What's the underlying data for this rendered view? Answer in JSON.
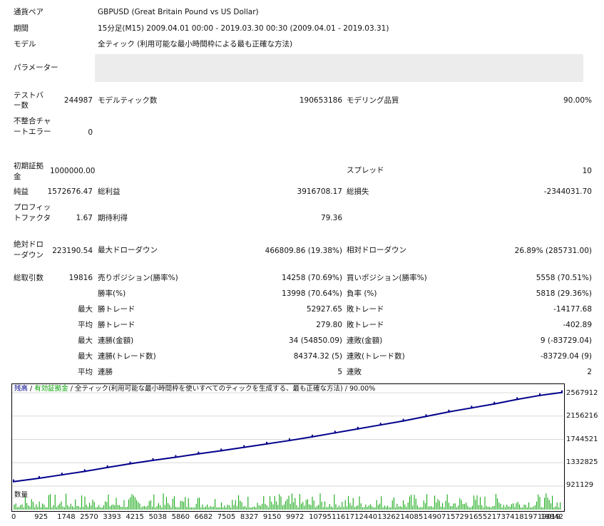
{
  "header": {
    "pair_label": "通貨ペア",
    "pair_value": "GBPUSD (Great Britain Pound vs US Dollar)",
    "period_label": "期間",
    "period_value": "15分足(M15) 2009.04.01 00:00 - 2019.03.30 00:30 (2009.04.01 - 2019.03.31)",
    "model_label": "モデル",
    "model_value": "全ティック (利用可能な最小時間枠による最も正確な方法)",
    "params_label": "パラメーター"
  },
  "stats": {
    "bars_label": "テストバー数",
    "bars_value": "244987",
    "ticks_label": "モデルティック数",
    "ticks_value": "190653186",
    "quality_label": "モデリング品質",
    "quality_value": "90.00%",
    "mismatch_label": "不整合チャートエラー",
    "mismatch_value": "0",
    "deposit_label": "初期証拠金",
    "deposit_value": "1000000.00",
    "spread_label": "スプレッド",
    "spread_value": "10",
    "net_label": "純益",
    "net_value": "1572676.47",
    "gross_profit_label": "総利益",
    "gross_profit_value": "3916708.17",
    "gross_loss_label": "総損失",
    "gross_loss_value": "-2344031.70",
    "pf_label": "プロフィットファクタ",
    "pf_value": "1.67",
    "expected_label": "期待利得",
    "expected_value": "79.36",
    "abs_dd_label": "絶対ドローダウン",
    "abs_dd_value": "223190.54",
    "max_dd_label": "最大ドローダウン",
    "max_dd_value": "466809.86 (19.38%)",
    "rel_dd_label": "相対ドローダウン",
    "rel_dd_value": "26.89% (285731.00)",
    "total_trades_label": "総取引数",
    "total_trades_value": "19816",
    "short_label": "売りポジション(勝率%)",
    "short_value": "14258 (70.69%)",
    "long_label": "買いポジション(勝率%)",
    "long_value": "5558 (70.51%)",
    "win_label": "勝率(%)",
    "win_value": "13998 (70.64%)",
    "loss_label": "負率 (%)",
    "loss_value": "5818 (29.36%)",
    "max_word": "最大",
    "avg_word": "平均",
    "largest_win_label": "勝トレード",
    "largest_win_value": "52927.65",
    "largest_loss_label": "敗トレード",
    "largest_loss_value": "-14177.68",
    "avg_win_label": "勝トレード",
    "avg_win_value": "279.80",
    "avg_loss_label": "敗トレード",
    "avg_loss_value": "-402.89",
    "cons_wins_money_label": "連勝(金額)",
    "cons_wins_money_value": "34 (54850.09)",
    "cons_loss_money_label": "連敗(金額)",
    "cons_loss_money_value": "9 (-83729.04)",
    "cons_profit_label": "連勝(トレード数)",
    "cons_profit_value": "84374.32 (5)",
    "cons_loss_trades_label": "連敗(トレード数)",
    "cons_loss_trades_value": "-83729.04 (9)",
    "avg_cons_wins_label": "連勝",
    "avg_cons_wins_value": "5",
    "avg_cons_loss_label": "連敗",
    "avg_cons_loss_value": "2"
  },
  "chart_legend": {
    "balance": "残高",
    "sep1": " / ",
    "equity": "有効証拠金",
    "sep2": " / ",
    "model": "全ティック(利用可能な最小時間枠を使いすべてのティックを生成する、最も正確な方法) / 90.00%"
  },
  "volume_label": "数量",
  "chart_data": {
    "type": "line",
    "series": [
      {
        "name": "残高",
        "x": [
          0,
          925,
          1748,
          2570,
          3393,
          4215,
          5038,
          5860,
          6682,
          7505,
          8327,
          9150,
          9972,
          10795,
          11617,
          12440,
          13262,
          14085,
          14907,
          15729,
          16552,
          17374,
          18197,
          19019,
          19816
        ],
        "values": [
          1000000,
          1060000,
          1120000,
          1180000,
          1250000,
          1315000,
          1375000,
          1430000,
          1490000,
          1545000,
          1605000,
          1665000,
          1725000,
          1790000,
          1860000,
          1930000,
          2000000,
          2070000,
          2150000,
          2230000,
          2300000,
          2370000,
          2450000,
          2520000,
          2572676
        ]
      }
    ],
    "y_ticks": [
      "2567912",
      "2156216",
      "1744521",
      "1332825",
      "921129"
    ],
    "x_ticks": [
      "0",
      "925",
      "1748",
      "2570",
      "3393",
      "4215",
      "5038",
      "5860",
      "6682",
      "7505",
      "8327",
      "9150",
      "9972",
      "10795",
      "11617",
      "12440",
      "13262",
      "14085",
      "14907",
      "15729",
      "16552",
      "17374",
      "18197",
      "19019",
      "19842"
    ],
    "ylim": [
      921129,
      2567912
    ],
    "xlim": [
      0,
      19842
    ],
    "colors": {
      "balance": "#00008b",
      "equity": "#00a000",
      "volume": "#00a000"
    }
  }
}
